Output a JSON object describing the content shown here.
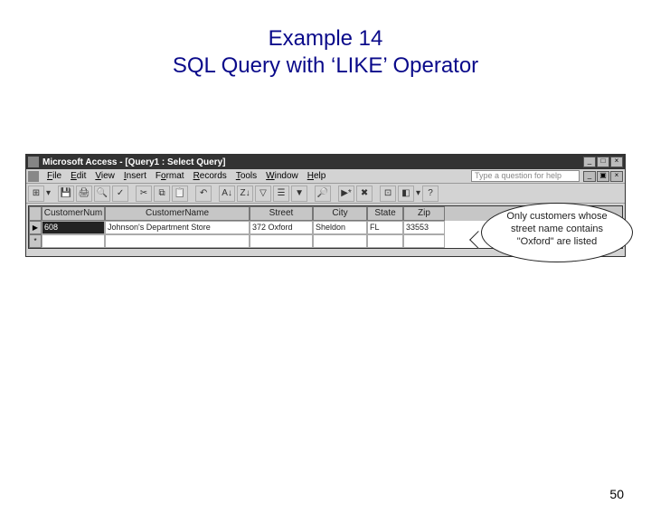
{
  "slide": {
    "title_line1": "Example 14",
    "title_line2": "SQL Query with ‘LIKE’ Operator",
    "page_number": "50"
  },
  "window": {
    "title": "Microsoft Access - [Query1 : Select Query]",
    "help_placeholder": "Type a question for help",
    "minimize": "_",
    "maximize": "□",
    "close": "×",
    "mdi_minimize": "_",
    "mdi_restore": "▣",
    "mdi_close": "×"
  },
  "menus": {
    "file": "File",
    "edit": "Edit",
    "view": "View",
    "insert": "Insert",
    "format": "Format",
    "records": "Records",
    "tools": "Tools",
    "window": "Window",
    "help": "Help"
  },
  "toolbar_icons": [
    "view-icon",
    "save-icon",
    "print-icon",
    "print-preview-icon",
    "spell-icon",
    "cut-icon",
    "copy-icon",
    "paste-icon",
    "undo-icon",
    "sort-asc-icon",
    "sort-desc-icon",
    "filter-selection-icon",
    "filter-form-icon",
    "apply-filter-icon",
    "find-icon",
    "new-record-icon",
    "delete-record-icon",
    "database-window-icon",
    "new-object-icon",
    "help-icon"
  ],
  "columns": {
    "customer_num": "CustomerNum",
    "customer_name": "CustomerName",
    "street": "Street",
    "city": "City",
    "state": "State",
    "zip": "Zip"
  },
  "row_markers": {
    "current": "▶",
    "new": "*"
  },
  "rows": [
    {
      "customer_num": "608",
      "customer_name": "Johnson's Department Store",
      "street": "372 Oxford",
      "city": "Sheldon",
      "state": "FL",
      "zip": "33553"
    }
  ],
  "callout": {
    "line1": "Only customers whose",
    "line2": "street name contains",
    "line3": "\"Oxford\" are listed"
  }
}
